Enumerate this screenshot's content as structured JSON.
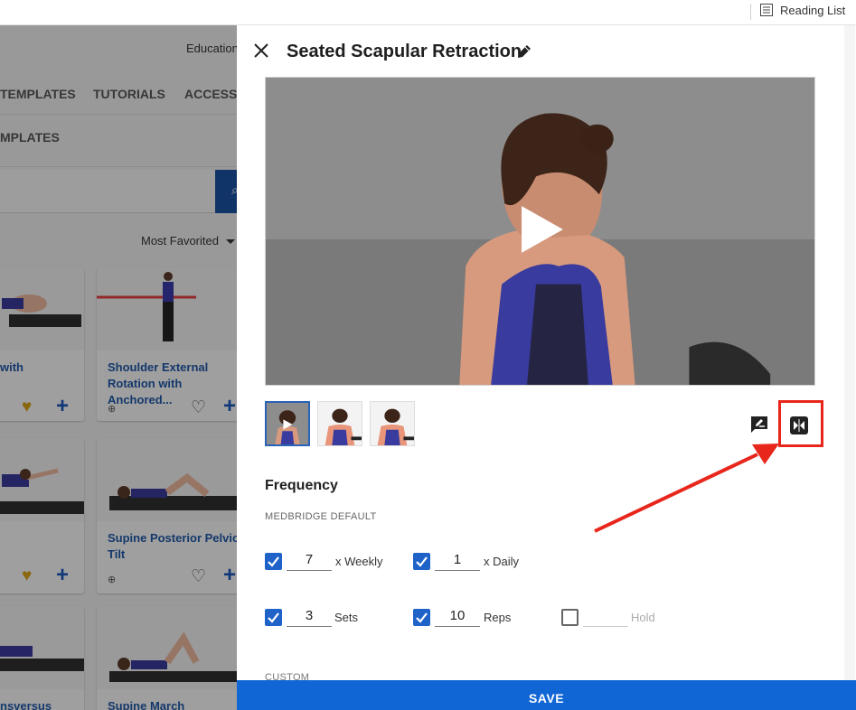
{
  "browser": {
    "reading_list_label": "Reading List"
  },
  "background": {
    "education_label": "Education",
    "nav_tabs": [
      "TEMPLATES",
      "TUTORIALS",
      "ACCESS"
    ],
    "section_label": "MPLATES",
    "sort_label": "Most Favorited",
    "cards": [
      {
        "title": "with",
        "favorited": true
      },
      {
        "title": "Shoulder External Rotation with Anchored...",
        "favorited": false
      },
      {
        "title": "",
        "favorited": true
      },
      {
        "title": "Supine Posterior Pelvic Tilt",
        "favorited": false
      },
      {
        "title": "nsversus",
        "favorited": false
      },
      {
        "title": "Supine March",
        "favorited": false
      }
    ]
  },
  "panel": {
    "title": "Seated Scapular Retraction",
    "frequency": {
      "heading": "Frequency",
      "subheading": "MEDBRIDGE DEFAULT",
      "weekly": {
        "checked": true,
        "value": "7",
        "label": "x Weekly"
      },
      "daily": {
        "checked": true,
        "value": "1",
        "label": "x Daily"
      },
      "sets": {
        "checked": true,
        "value": "3",
        "label": "Sets"
      },
      "reps": {
        "checked": true,
        "value": "10",
        "label": "Reps"
      },
      "hold": {
        "checked": false,
        "value": "",
        "label": "Hold"
      }
    },
    "custom_label": "CUSTOM",
    "save_label": "SAVE"
  },
  "colors": {
    "accent": "#1166d6",
    "highlight": "#e8261c",
    "checkbox": "#1f63c9",
    "link": "#2057a5"
  }
}
